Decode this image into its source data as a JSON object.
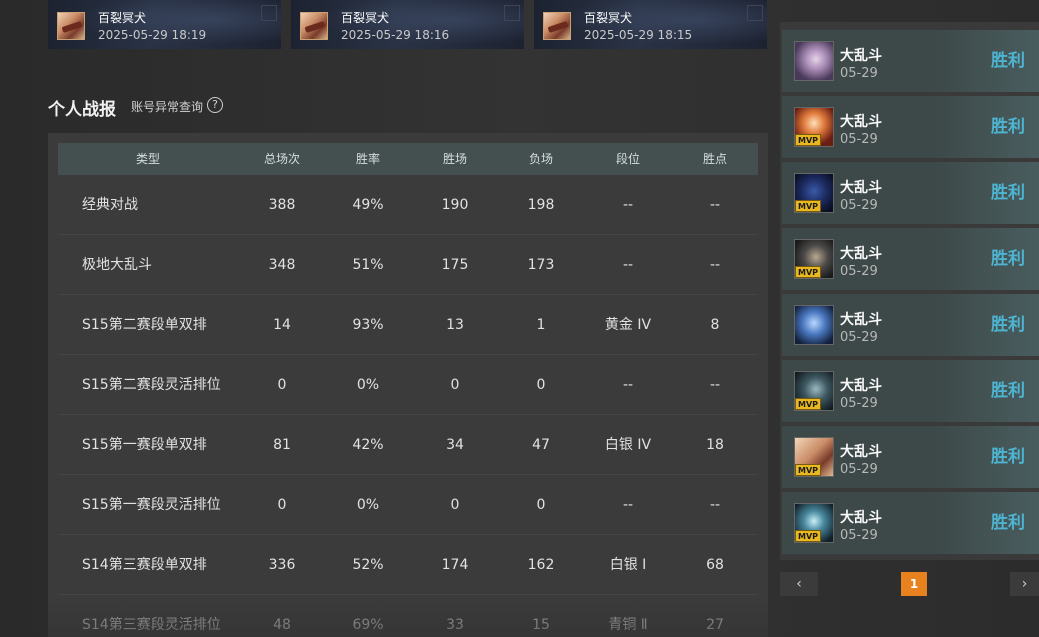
{
  "recent_matches": [
    {
      "name": "百裂冥犬",
      "time": "2025-05-29 18:19"
    },
    {
      "name": "百裂冥犬",
      "time": "2025-05-29 18:16"
    },
    {
      "name": "百裂冥犬",
      "time": "2025-05-29 18:15"
    }
  ],
  "section": {
    "title": "个人战报",
    "abnormal_link": "账号异常查询",
    "help_glyph": "?"
  },
  "stats_table": {
    "headers": [
      "类型",
      "总场次",
      "胜率",
      "胜场",
      "负场",
      "段位",
      "胜点"
    ],
    "rows": [
      [
        "经典对战",
        "388",
        "49%",
        "190",
        "198",
        "--",
        "--"
      ],
      [
        "极地大乱斗",
        "348",
        "51%",
        "175",
        "173",
        "--",
        "--"
      ],
      [
        "S15第二赛段单双排",
        "14",
        "93%",
        "13",
        "1",
        "黄金 IV",
        "8"
      ],
      [
        "S15第二赛段灵活排位",
        "0",
        "0%",
        "0",
        "0",
        "--",
        "--"
      ],
      [
        "S15第一赛段单双排",
        "81",
        "42%",
        "34",
        "47",
        "白银 IV",
        "18"
      ],
      [
        "S15第一赛段灵活排位",
        "0",
        "0%",
        "0",
        "0",
        "--",
        "--"
      ],
      [
        "S14第三赛段单双排",
        "336",
        "52%",
        "174",
        "162",
        "白银 Ⅰ",
        "68"
      ],
      [
        "S14第三赛段灵活排位",
        "48",
        "69%",
        "33",
        "15",
        "青铜 Ⅱ",
        "27"
      ]
    ]
  },
  "match_list": [
    {
      "mode": "大乱斗",
      "date": "05-29",
      "result": "胜利",
      "mvp": ""
    },
    {
      "mode": "大乱斗",
      "date": "05-29",
      "result": "胜利",
      "mvp": "MVP"
    },
    {
      "mode": "大乱斗",
      "date": "05-29",
      "result": "胜利",
      "mvp": "MVP"
    },
    {
      "mode": "大乱斗",
      "date": "05-29",
      "result": "胜利",
      "mvp": "MVP"
    },
    {
      "mode": "大乱斗",
      "date": "05-29",
      "result": "胜利",
      "mvp": ""
    },
    {
      "mode": "大乱斗",
      "date": "05-29",
      "result": "胜利",
      "mvp": "MVP"
    },
    {
      "mode": "大乱斗",
      "date": "05-29",
      "result": "胜利",
      "mvp": "MVP"
    },
    {
      "mode": "大乱斗",
      "date": "05-29",
      "result": "胜利",
      "mvp": "MVP"
    }
  ],
  "pagination": {
    "prev": "‹",
    "current": "1",
    "next": "›"
  },
  "colors": {
    "accent_win": "#4db4d2",
    "page_active": "#e8821e",
    "mvp": "#e8b820"
  }
}
